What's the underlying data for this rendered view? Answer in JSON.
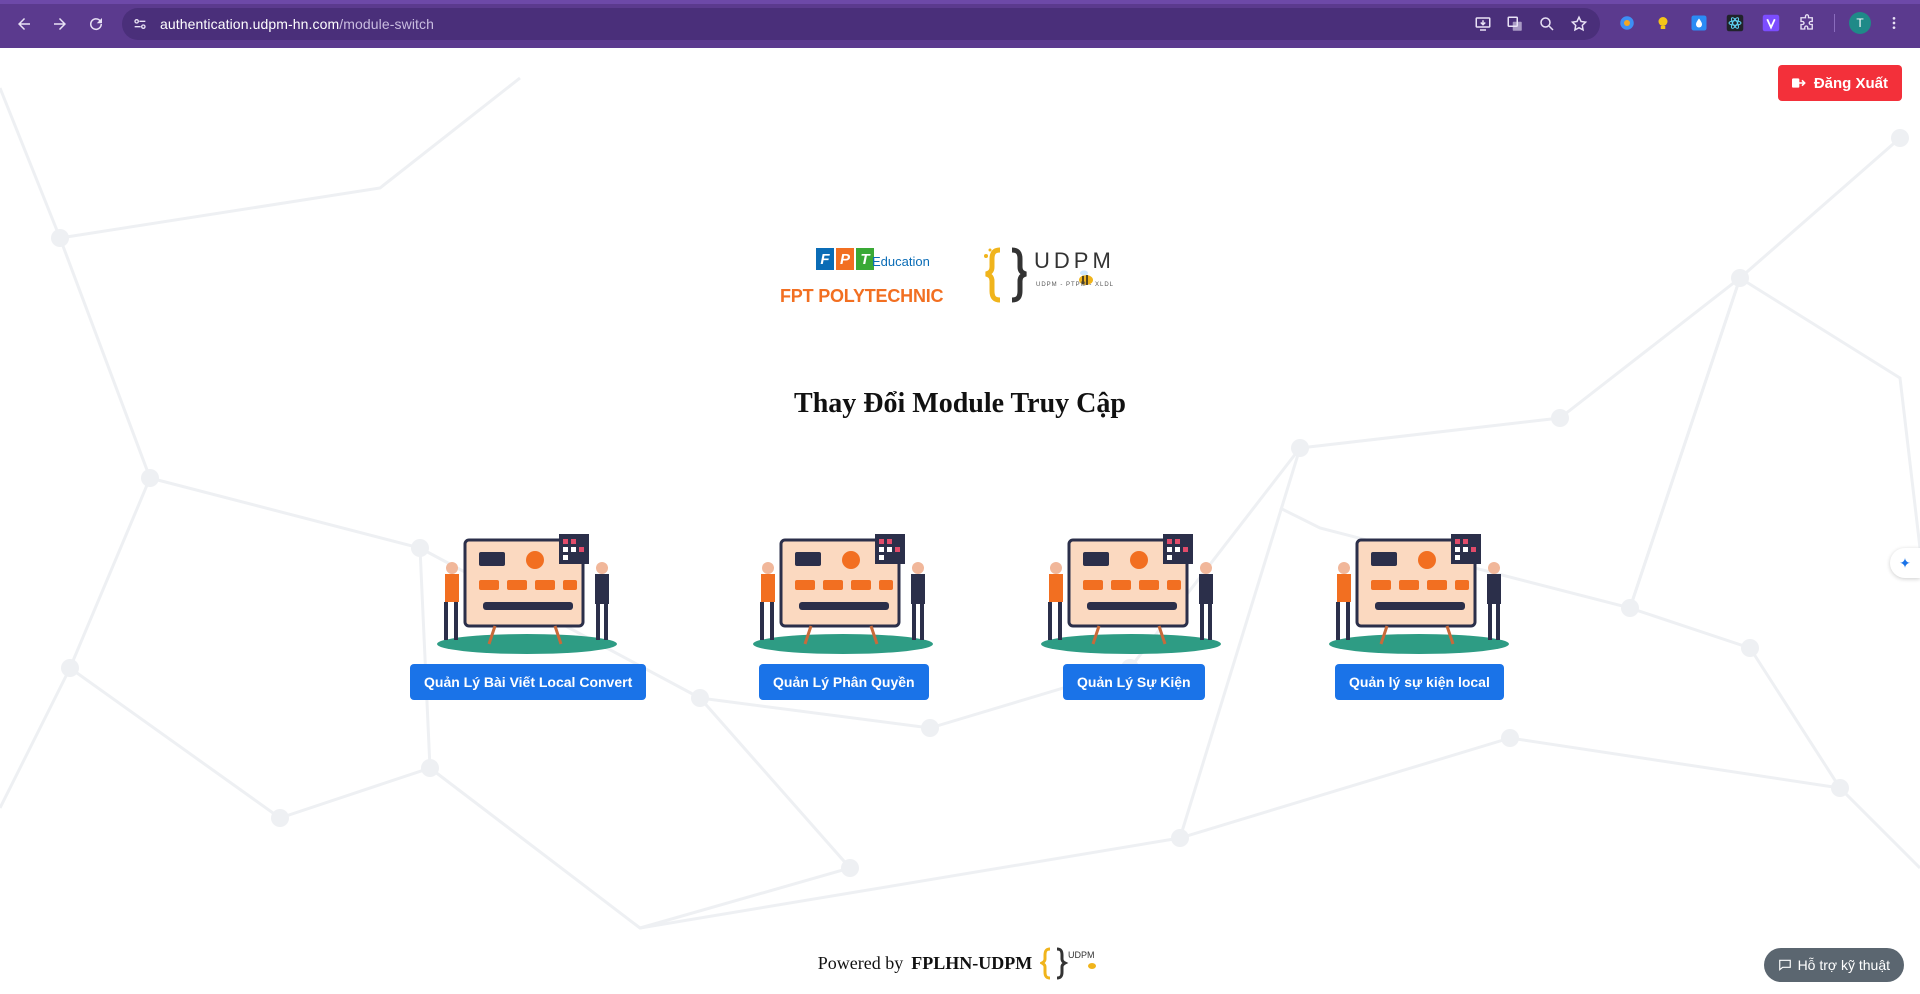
{
  "browser": {
    "url_host": "authentication.udpm-hn.com",
    "url_path": "/module-switch",
    "profile_initial": "T",
    "accent": "#5b3a8e"
  },
  "header": {
    "logout_label": "Đăng Xuất",
    "logout_color": "#f3303a"
  },
  "logos": {
    "fpt_name": "FPT POLYTECHNIC",
    "fpt_edu": "Education",
    "fpt_letters": [
      "F",
      "P",
      "T"
    ],
    "udpm_name": "UDPM",
    "udpm_sub": "UDPM - PTPM - XLDL"
  },
  "main": {
    "title": "Thay Đổi Module Truy Cập",
    "modules": [
      {
        "label": "Quản Lý Bài Viết Local Convert"
      },
      {
        "label": "Quản Lý Phân Quyền"
      },
      {
        "label": "Quản Lý Sự Kiện"
      },
      {
        "label": "Quản lý sự kiện local"
      }
    ],
    "button_color": "#1a73e8"
  },
  "footer": {
    "powered_prefix": "Powered by",
    "powered_name": "FPLHN-UDPM"
  },
  "support": {
    "label": "Hỗ trợ kỹ thuật"
  }
}
